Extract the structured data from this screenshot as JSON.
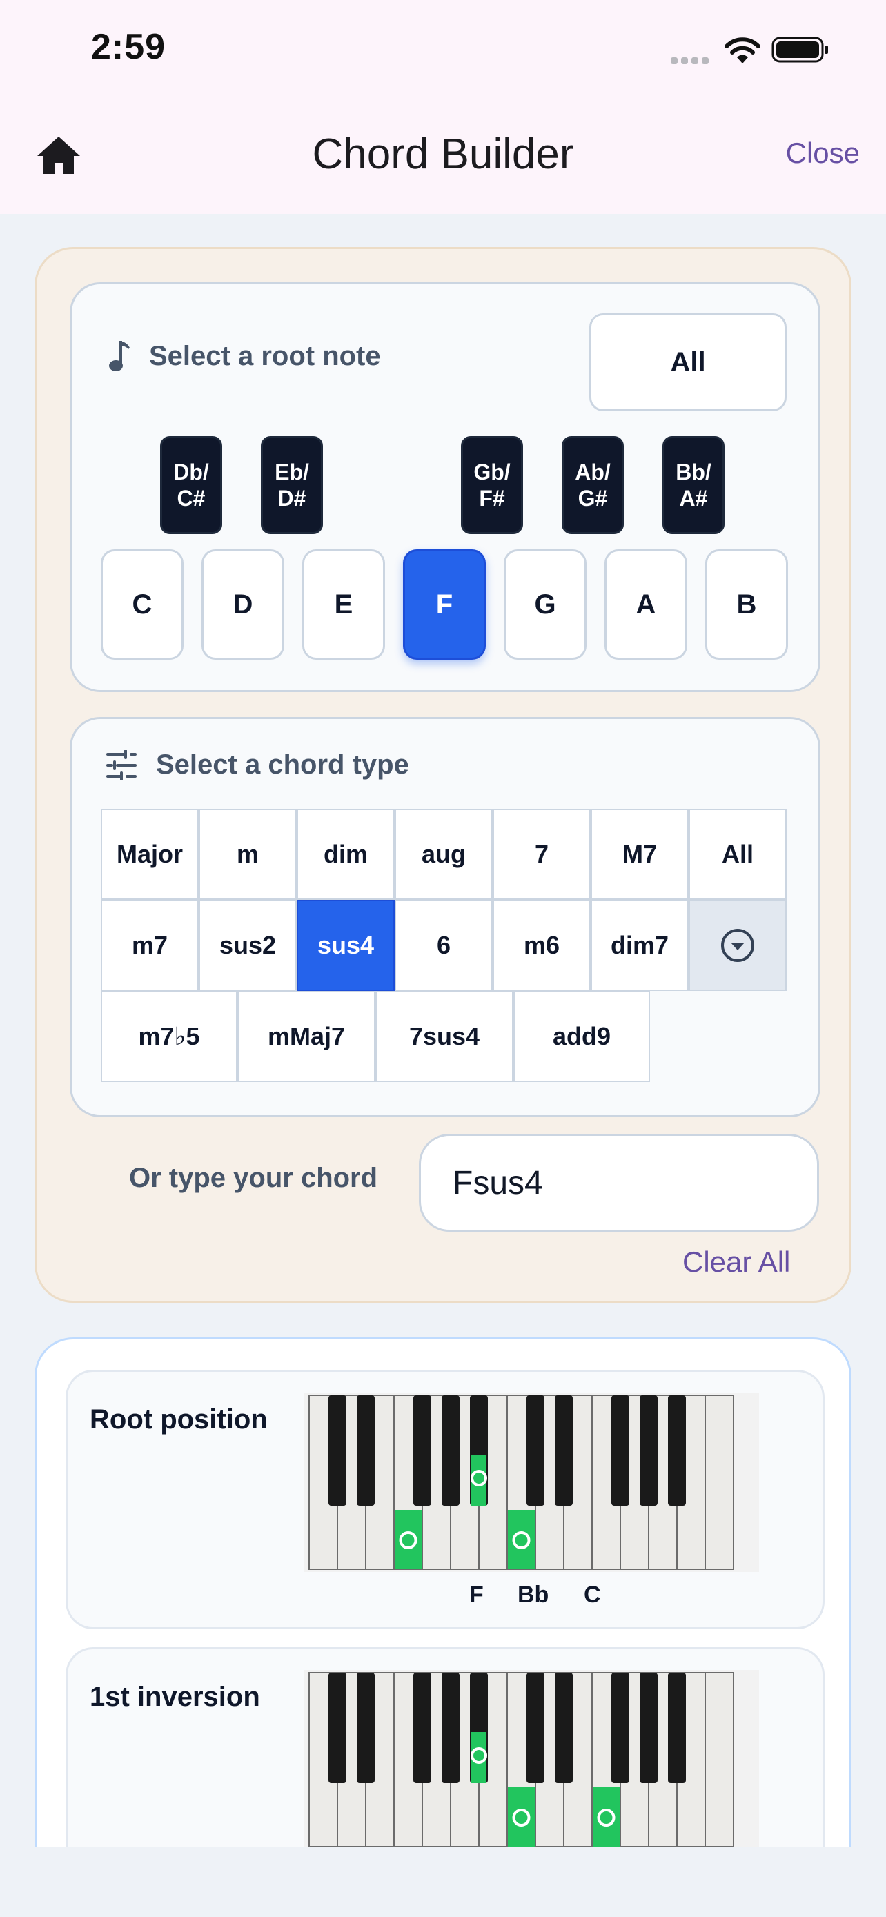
{
  "status": {
    "time": "2:59"
  },
  "nav": {
    "title": "Chord Builder",
    "close": "Close"
  },
  "root_section": {
    "label": "Select a root note",
    "all_button": "All",
    "black_keys": [
      {
        "line1": "Db/",
        "line2": "C#"
      },
      {
        "line1": "Eb/",
        "line2": "D#"
      },
      {
        "line1": "Gb/",
        "line2": "F#"
      },
      {
        "line1": "Ab/",
        "line2": "G#"
      },
      {
        "line1": "Bb/",
        "line2": "A#"
      }
    ],
    "white_keys": [
      "C",
      "D",
      "E",
      "F",
      "G",
      "A",
      "B"
    ],
    "selected": "F"
  },
  "chord_type_section": {
    "label": "Select a chord type",
    "row1": [
      "Major",
      "m",
      "dim",
      "aug",
      "7",
      "M7",
      "All"
    ],
    "row2": [
      "m7",
      "sus2",
      "sus4",
      "6",
      "m6",
      "dim7"
    ],
    "row3": [
      "m7♭5",
      "mMaj7",
      "7sus4",
      "add9"
    ],
    "selected": "sus4"
  },
  "chord_input": {
    "label": "Or type your chord",
    "value": "Fsus4",
    "clear": "Clear All"
  },
  "voicings": [
    {
      "title": "Root position",
      "notes": [
        "F",
        "Bb",
        "C"
      ]
    },
    {
      "title": "1st inversion"
    }
  ],
  "colors": {
    "accent": "#2563eb",
    "highlight": "#22c55e",
    "link": "#6750a4"
  }
}
